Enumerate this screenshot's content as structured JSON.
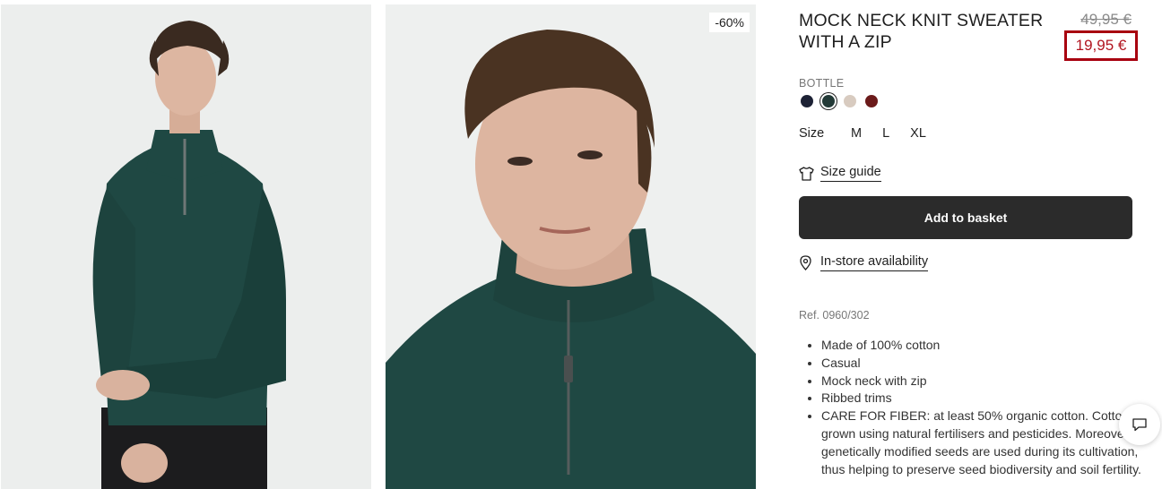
{
  "product": {
    "discount_badge": "-60%",
    "title": "MOCK NECK KNIT SWEATER WITH A ZIP",
    "original_price": "49,95 €",
    "sale_price": "19,95 €",
    "color_name": "BOTTLE",
    "swatches": [
      {
        "name": "navy",
        "color": "#1d2235"
      },
      {
        "name": "bottle",
        "color": "#233a37",
        "selected": true
      },
      {
        "name": "beige",
        "color": "#d8cbc0"
      },
      {
        "name": "burgundy",
        "color": "#6b1a1a"
      }
    ],
    "size_label": "Size",
    "sizes": [
      "M",
      "L",
      "XL"
    ],
    "size_guide_label": "Size guide",
    "add_to_basket_label": "Add to basket",
    "in_store_label": "In-store availability",
    "reference": "Ref. 0960/302",
    "features": [
      "Made of 100% cotton",
      "Casual",
      "Mock neck with zip",
      "Ribbed trims",
      "CARE FOR FIBER: at least 50% organic cotton. Cotton grown using natural fertilisers and pesticides. Moreover, no genetically modified seeds are used during its cultivation, thus helping to preserve seed biodiversity and soil fertility."
    ]
  },
  "colors": {
    "sale_red": "#b1141f",
    "highlight_border": "#a8000f",
    "button_dark": "#2b2b2b",
    "sweater_green": "#1f4843"
  },
  "icons": {
    "size_guide": "tshirt-icon",
    "store": "location-pin-icon",
    "chat": "chat-bubble-icon"
  }
}
